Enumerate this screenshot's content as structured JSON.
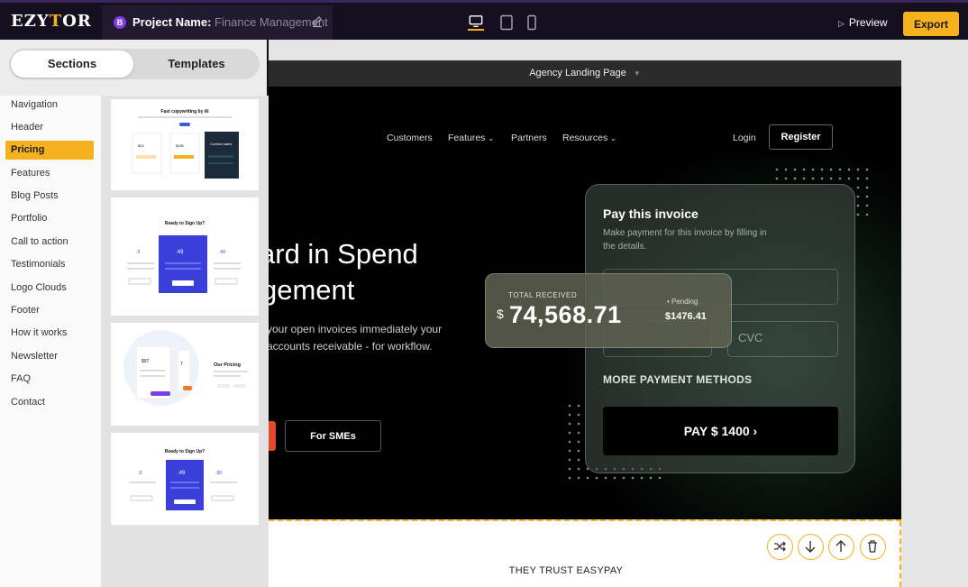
{
  "app": {
    "logo": "EZYTOR",
    "project_label": "Project Name:",
    "project_value": "Finance Management",
    "project_badge": "B",
    "preview_label": "Preview",
    "export_label": "Export",
    "accent_color": "#f5b21e"
  },
  "sidebar": {
    "tabs": [
      "Sections",
      "Templates"
    ],
    "active_tab": "Sections",
    "categories": [
      "Navigation",
      "Header",
      "Pricing",
      "Features",
      "Blog Posts",
      "Portfolio",
      "Call to action",
      "Testimonials",
      "Logo Clouds",
      "Footer",
      "How it works",
      "Newsletter",
      "FAQ",
      "Contact"
    ],
    "selected_category": "Pricing",
    "thumbnails": [
      {
        "title": "Fast copywriting by AI",
        "columns": [
          "$24",
          "$180",
          "Contact sales"
        ]
      },
      {
        "title": "Ready to Sign Up?",
        "columns": [
          ".9",
          ".49",
          ".99"
        ]
      },
      {
        "title": "Our Pricing",
        "columns": [
          "$97",
          "7"
        ]
      },
      {
        "title": "Ready to Sign Up?",
        "columns": [
          ".9",
          ".49",
          ".99"
        ]
      }
    ]
  },
  "canvas": {
    "page_name": "Agency Landing Page",
    "nav": {
      "links": [
        "Customers",
        "Features",
        "Partners",
        "Resources"
      ],
      "login": "Login",
      "register": "Register"
    },
    "hero": {
      "headline_1": "ard in Spend",
      "headline_2": "gement",
      "description": "your open invoices immediately your accounts receivable - for workflow.",
      "secondary_cta": "For SMEs"
    },
    "invoice_card": {
      "title": "Pay this invoice",
      "subtitle": "Make payment for this invoice by filling in the details.",
      "cvc_placeholder": "CVC",
      "more_methods": "MORE PAYMENT METHODS",
      "pay_button": "PAY $ 1400  ›"
    },
    "total_card": {
      "label": "TOTAL RECEIVED",
      "currency": "$",
      "amount": "74,568.71",
      "pending_label": "• Pending",
      "pending_value": "$1476.41"
    },
    "below": {
      "trust_text": "THEY TRUST EASYPAY"
    }
  }
}
